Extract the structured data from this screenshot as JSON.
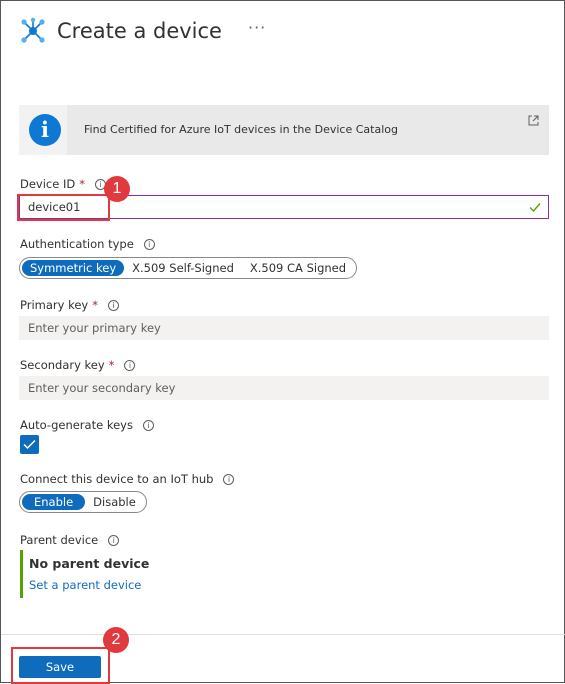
{
  "header": {
    "title": "Create a device",
    "more": "···"
  },
  "banner": {
    "text": "Find Certified for Azure IoT devices in the Device Catalog"
  },
  "device_id": {
    "label": "Device ID",
    "required": "*",
    "value": "device01"
  },
  "auth_type": {
    "label": "Authentication type",
    "options": [
      "Symmetric key",
      "X.509 Self-Signed",
      "X.509 CA Signed"
    ],
    "selected": "Symmetric key"
  },
  "primary_key": {
    "label": "Primary key",
    "required": "*",
    "placeholder": "Enter your primary key"
  },
  "secondary_key": {
    "label": "Secondary key",
    "required": "*",
    "placeholder": "Enter your secondary key"
  },
  "auto_generate": {
    "label": "Auto-generate keys",
    "checked": true
  },
  "connect_hub": {
    "label": "Connect this device to an IoT hub",
    "options": [
      "Enable",
      "Disable"
    ],
    "selected": "Enable"
  },
  "parent_device": {
    "label": "Parent device",
    "value": "No parent device",
    "link": "Set a parent device"
  },
  "footer": {
    "save_label": "Save"
  },
  "annotations": {
    "step1": "1",
    "step2": "2"
  },
  "colors": {
    "accent": "#0f6cbd",
    "annotation": "#e0393e",
    "valid": "#57a300"
  },
  "icons": {
    "header": "iot-hub-icon",
    "banner": "info-icon",
    "external": "external-link-icon",
    "valid": "checkmark-icon"
  }
}
